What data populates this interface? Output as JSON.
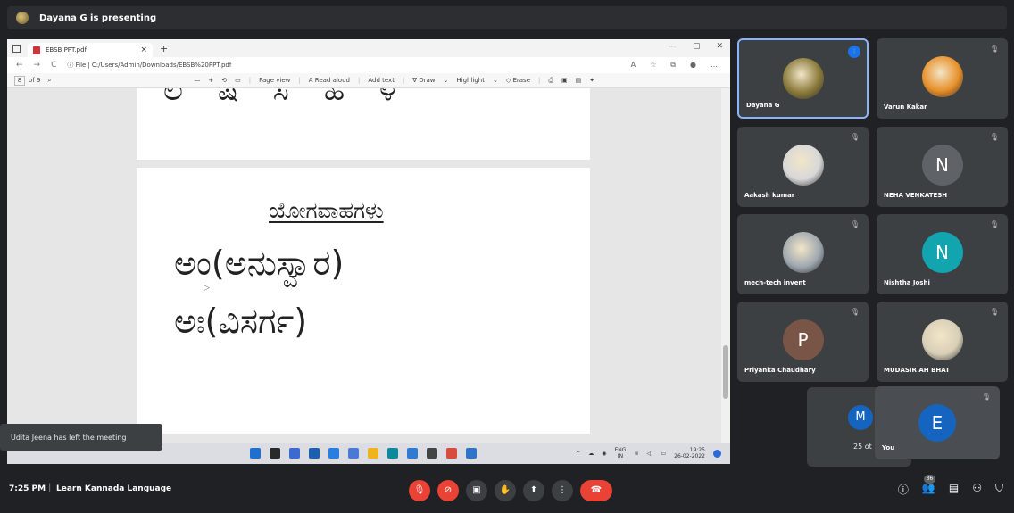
{
  "presenting": {
    "text": "Dayana G is presenting"
  },
  "browser": {
    "tab_title": "EBSB PPT.pdf",
    "tab_close": "×",
    "new_tab": "+",
    "window_controls": [
      "—",
      "▢",
      "✕"
    ],
    "address_prefix": "ⓘ File |",
    "url": "C:/Users/Admin/Downloads/EBSB%20PPT.pdf"
  },
  "pdf_toolbar": {
    "page_current": "8",
    "page_total": "of 9",
    "items": [
      "—",
      "+",
      "⟲",
      "▭",
      "|",
      "Page view",
      "|",
      "A Read aloud",
      "|",
      "Add text",
      "|",
      "∇ Draw",
      "⌄",
      "Highlight",
      "⌄",
      "◇ Erase",
      "|",
      "⎙",
      "▣",
      "▤",
      "✦"
    ]
  },
  "slide": {
    "top_fragment": "ಲ ಷ ಸ ಹ ಳ",
    "heading": "ಯೋಗವಾಹಗಳು",
    "line1": "ಅಂ(ಅನುಸ್ವಾರ)",
    "line2": "ಅಃ(ವಿಸರ್ಗ)"
  },
  "taskbar": {
    "icon_colors": [
      "#1f6fd1",
      "#2a2a2a",
      "#3b6ad0",
      "#1b5fb3",
      "#2a7de1",
      "#4a7bd4",
      "#f1b31c",
      "#0c8a9d",
      "#2e7bd1",
      "#444",
      "#d94b3c",
      "#2f74c9"
    ],
    "tray_arrow": "^",
    "lang_top": "ENG",
    "lang_bottom": "IN",
    "clock_time": "19:25",
    "clock_date": "26-02-2022"
  },
  "toast": {
    "text": "Udita Jeena has left the meeting"
  },
  "participants": [
    {
      "name": "Dayana G",
      "type": "photo",
      "color": "#8a7a3a",
      "active": true
    },
    {
      "name": "Varun Kakar",
      "type": "photo",
      "color": "#e8902a",
      "active": false
    },
    {
      "name": "Aakash kumar",
      "type": "photo",
      "color": "#d8d8d8",
      "active": false
    },
    {
      "name": "NEHA VENKATESH",
      "type": "initial",
      "initial": "N",
      "color": "#5f6368",
      "active": false
    },
    {
      "name": "mech-tech invent",
      "type": "photo",
      "color": "#a0a8b0",
      "active": false
    },
    {
      "name": "Nishtha Joshi",
      "type": "initial",
      "initial": "N",
      "color": "#12a4af",
      "active": false
    },
    {
      "name": "Priyanka Chaudhary",
      "type": "initial",
      "initial": "P",
      "color": "#795548",
      "active": false
    },
    {
      "name": "MUDASIR AH BHAT",
      "type": "photo",
      "color": "#d8cfb8",
      "active": false
    }
  ],
  "self": {
    "behind_initial": "M",
    "behind_text": "25 ot",
    "initial": "E",
    "label": "You",
    "avatar_color": "#1565c0"
  },
  "bottom_bar": {
    "time": "7:25 PM",
    "separator": "|",
    "meeting_title": "Learn Kannada Language",
    "people_count": "36"
  },
  "icons": {
    "mic_off": "🎙",
    "cam_off": "⊘",
    "captions": "▣",
    "raise_hand": "✋",
    "present": "⬆",
    "more": "⋮",
    "end_call": "☎",
    "info": "ⓘ",
    "people": "👥",
    "chat": "▤",
    "activities": "⚇",
    "host": "⛉",
    "mute": "🎙",
    "speak": "⫶"
  }
}
